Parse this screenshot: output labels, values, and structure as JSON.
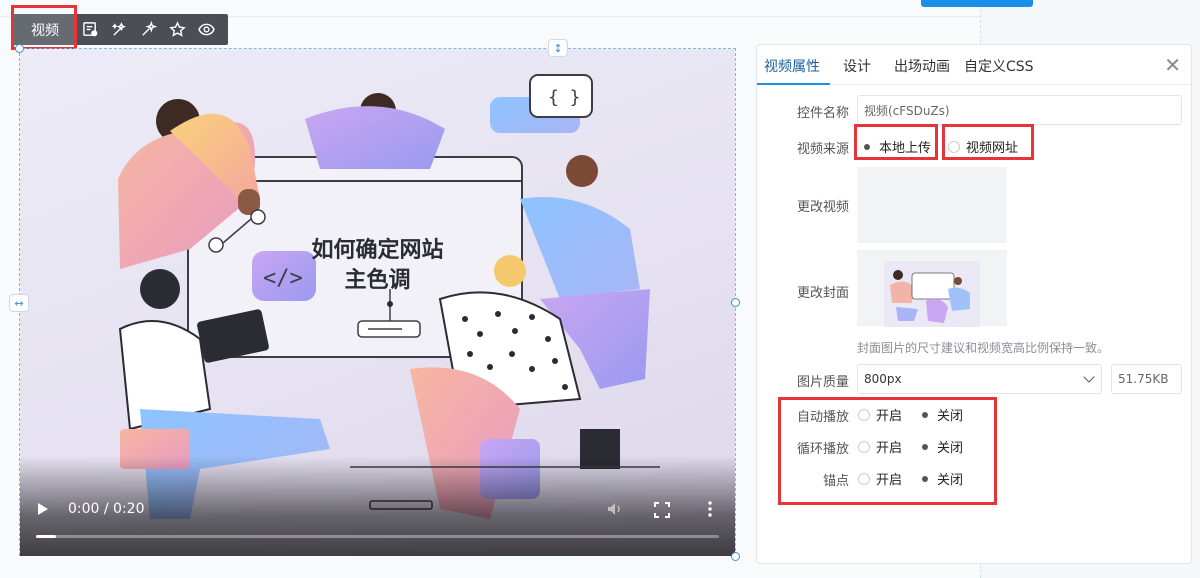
{
  "toolbar": {
    "label": "视频",
    "icons": [
      "form-settings-icon",
      "magic-wand-icon",
      "sparkle-icon",
      "star-icon",
      "eye-icon"
    ]
  },
  "video": {
    "title_line1": "如何确定网站",
    "title_line2": "主色调",
    "time": "0:00 / 0:20",
    "progress": 0.03
  },
  "panel": {
    "tabs": [
      "视频属性",
      "设计",
      "出场动画",
      "自定义CSS"
    ],
    "close": "✕",
    "control_name_label": "控件名称",
    "control_name_value": "视频(cFSDuZs)",
    "source_label": "视频来源",
    "source_local": "本地上传",
    "source_url": "视频网址",
    "change_video_label": "更改视频",
    "change_cover_label": "更改封面",
    "cover_hint": "封面图片的尺寸建议和视频宽高比例保持一致。",
    "quality_label": "图片质量",
    "quality_value": "800px",
    "file_size": "51.75KB",
    "autoplay_label": "自动播放",
    "loop_label": "循环播放",
    "anchor_label": "锚点",
    "on": "开启",
    "off": "关闭"
  },
  "colors": {
    "accent": "#1a8fe8",
    "highlight": "#e5343a",
    "toolbar": "#4b4f55"
  }
}
